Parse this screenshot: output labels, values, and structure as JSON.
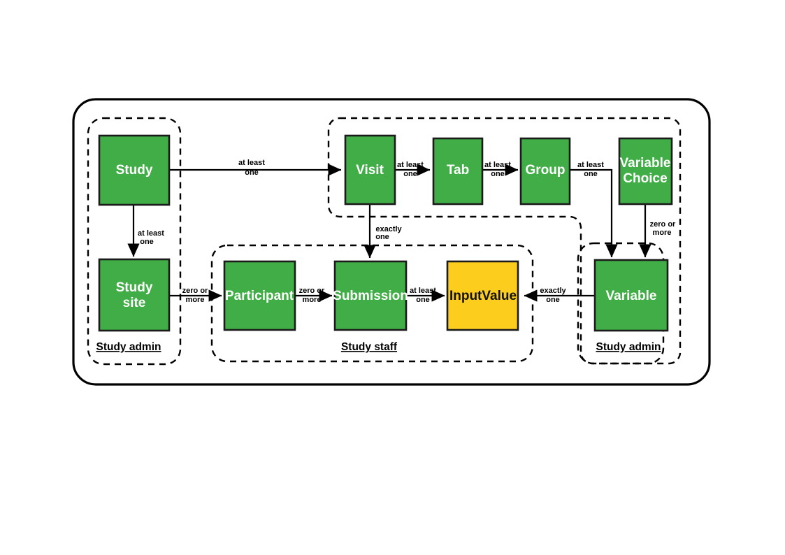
{
  "diagram": {
    "title": "Study data model entity relationship diagram",
    "colors": {
      "entity_green": "#41ad46",
      "entity_yellow": "#fdcd1e",
      "stroke": "#000000",
      "label_on_green": "#ffffff",
      "label_on_yellow": "#111111"
    },
    "entities": [
      {
        "id": "study",
        "label": "Study",
        "label_line1": "Study",
        "label_line2": "",
        "color": "green"
      },
      {
        "id": "study-site",
        "label": "Study site",
        "label_line1": "Study",
        "label_line2": "site",
        "color": "green"
      },
      {
        "id": "visit",
        "label": "Visit",
        "label_line1": "Visit",
        "label_line2": "",
        "color": "green"
      },
      {
        "id": "tab",
        "label": "Tab",
        "label_line1": "Tab",
        "label_line2": "",
        "color": "green"
      },
      {
        "id": "group",
        "label": "Group",
        "label_line1": "Group",
        "label_line2": "",
        "color": "green"
      },
      {
        "id": "variable-choice",
        "label": "Variable Choice",
        "label_line1": "Variable",
        "label_line2": "Choice",
        "color": "green"
      },
      {
        "id": "participant",
        "label": "Participant",
        "label_line1": "Participant",
        "label_line2": "",
        "color": "green"
      },
      {
        "id": "submission",
        "label": "Submission",
        "label_line1": "Submission",
        "label_line2": "",
        "color": "green"
      },
      {
        "id": "input-value",
        "label": "InputValue",
        "label_line1": "InputValue",
        "label_line2": "",
        "color": "yellow"
      },
      {
        "id": "variable",
        "label": "Variable",
        "label_line1": "Variable",
        "label_line2": "",
        "color": "green"
      }
    ],
    "groups": [
      {
        "id": "study-admin-left",
        "label": "Study admin"
      },
      {
        "id": "study-staff",
        "label": "Study staff"
      },
      {
        "id": "study-admin-right",
        "label": "Study admin"
      },
      {
        "id": "visit-structure",
        "label": ""
      }
    ],
    "relationships": [
      {
        "id": "study-to-visit",
        "from": "Study",
        "to": "Visit",
        "cardinality": "at least one",
        "line1": "at least",
        "line2": "one"
      },
      {
        "id": "study-to-study-site",
        "from": "Study",
        "to": "Study site",
        "cardinality": "at least one",
        "line1": "at least",
        "line2": "one"
      },
      {
        "id": "visit-to-tab",
        "from": "Visit",
        "to": "Tab",
        "cardinality": "at least one",
        "line1": "at least",
        "line2": "one"
      },
      {
        "id": "tab-to-group",
        "from": "Tab",
        "to": "Group",
        "cardinality": "at least one",
        "line1": "at least",
        "line2": "one"
      },
      {
        "id": "group-to-variable",
        "from": "Group",
        "to": "Variable",
        "cardinality": "at least one",
        "line1": "at least",
        "line2": "one"
      },
      {
        "id": "visit-to-submission",
        "from": "Visit",
        "to": "Submission",
        "cardinality": "exactly one",
        "line1": "exactly",
        "line2": "one"
      },
      {
        "id": "variable-choice-to-variable",
        "from": "Variable Choice",
        "to": "Variable",
        "cardinality": "zero or more",
        "line1": "zero or",
        "line2": "more"
      },
      {
        "id": "study-site-to-participant",
        "from": "Study site",
        "to": "Participant",
        "cardinality": "zero or more",
        "line1": "zero or",
        "line2": "more"
      },
      {
        "id": "participant-to-submission",
        "from": "Participant",
        "to": "Submission",
        "cardinality": "zero or more",
        "line1": "zero or",
        "line2": "more"
      },
      {
        "id": "submission-to-input-value",
        "from": "Submission",
        "to": "InputValue",
        "cardinality": "at least one",
        "line1": "at least",
        "line2": "one"
      },
      {
        "id": "variable-to-input-value",
        "from": "Variable",
        "to": "InputValue",
        "cardinality": "exactly one",
        "line1": "exactly",
        "line2": "one"
      }
    ]
  }
}
